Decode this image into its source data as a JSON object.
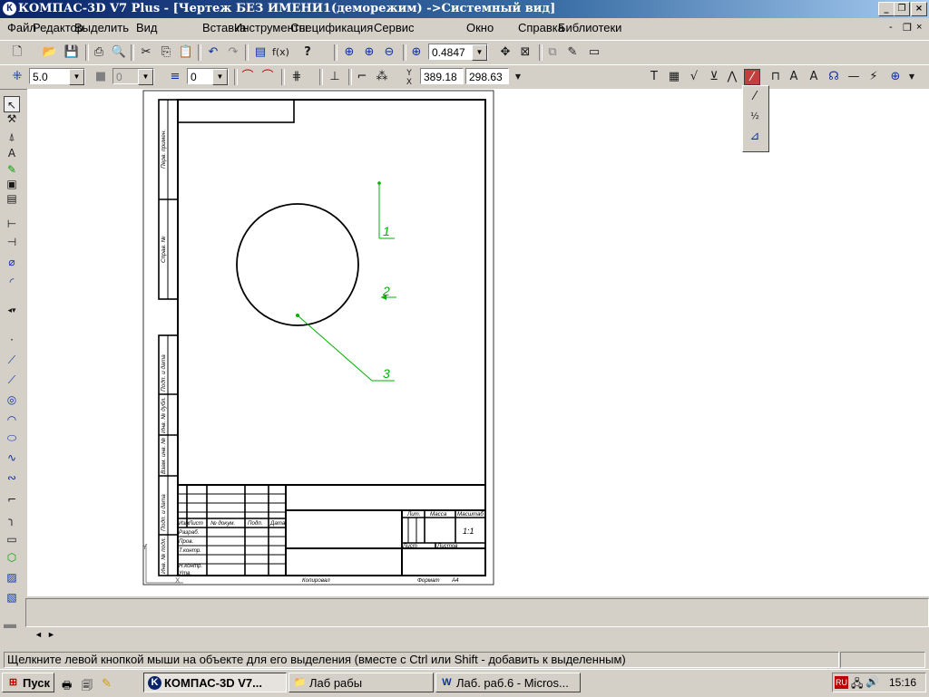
{
  "window": {
    "title": "КОМПАС-3D V7 Plus - [Чертеж БЕЗ ИМЕНИ1(деморежим) ->Системный вид]",
    "app_icon_letter": "К",
    "controls": {
      "minimize": "_",
      "restore": "❐",
      "close": "×"
    },
    "doc_controls": {
      "minimize": "-",
      "restore": "❐",
      "close": "×"
    }
  },
  "menu": [
    {
      "label": "Файл"
    },
    {
      "label": "Редактор"
    },
    {
      "label": "Выделить"
    },
    {
      "label": "Вид"
    },
    {
      "label": "Вставка"
    },
    {
      "label": "Инструменты"
    },
    {
      "label": "Спецификация"
    },
    {
      "label": "Сервис"
    },
    {
      "label": "Окно"
    },
    {
      "label": "Справка"
    },
    {
      "label": "Библиотеки"
    }
  ],
  "toolbar1": {
    "zoom_value": "0.4847",
    "icons": [
      "new-icon",
      "open-icon",
      "save-icon",
      "print-icon",
      "print-preview-icon",
      "cut-icon",
      "copy-icon",
      "paste-icon",
      "undo-icon",
      "redo-icon",
      "properties-icon",
      "variables-icon",
      "help-icon",
      "zoom-in-icon",
      "zoom-window-icon",
      "zoom-out-icon",
      "zoom-scale-icon",
      "pan-icon",
      "fit-icon",
      "layers-icon",
      "settings-icon",
      "display-icon"
    ]
  },
  "toolbar2": {
    "step_value": "5.0",
    "style_value": "0",
    "layer_value": "0",
    "coord_x": "389.18",
    "coord_y": "298.63",
    "coord_label": "Y",
    "coord_label_x": "X"
  },
  "popup": {
    "items": [
      "leader-line-icon",
      "position-leader-icon",
      "mark-leader-icon"
    ]
  },
  "drawing": {
    "leader_labels": [
      "1",
      "2",
      "3"
    ],
    "stamp": {
      "lit": "Лит.",
      "massa": "Масса",
      "masshtab": "Масштаб",
      "scale_value": "1:1",
      "list": "Лист",
      "listov": "Листов",
      "izm": "Изм",
      "list_col": "Лист",
      "doc_no": "№ докум.",
      "podp": "Подп.",
      "data": "Дата",
      "razrab": "Разраб.",
      "prov": "Пров.",
      "t_kontr": "Т.контр.",
      "n_kontr": "Н.контр.",
      "utv": "Утв.",
      "kopiroval": "Копировал",
      "format": "Формат",
      "format_value": "A4"
    },
    "side_stamp": [
      "Перв. примен.",
      "Справ. №",
      "Подп. и дата",
      "Инв. № дубл.",
      "Взам. инв. №",
      "Подп. и дата",
      "Инв. № подл."
    ],
    "axis_labels": {
      "y": "Y",
      "x": "X"
    }
  },
  "nav": {
    "prev": "◄",
    "next": "►"
  },
  "status": {
    "hint": "Щелкните левой кнопкой мыши на объекте для его выделения (вместе с Ctrl или Shift - добавить к выделенным)"
  },
  "taskbar": {
    "start": "Пуск",
    "buttons": [
      {
        "label": "КОМПАС-3D V7...",
        "icon": "kompas-icon",
        "active": true
      },
      {
        "label": "Лаб рабы",
        "icon": "folder-icon",
        "active": false
      },
      {
        "label": "Лаб. раб.6 - Micros...",
        "icon": "word-icon",
        "active": false
      }
    ],
    "lang": "RU",
    "clock": "15:16"
  },
  "colors": {
    "leader": "#00b000",
    "title_start": "#0a246a",
    "title_end": "#a6caf0",
    "active_tool": "#c04040"
  }
}
